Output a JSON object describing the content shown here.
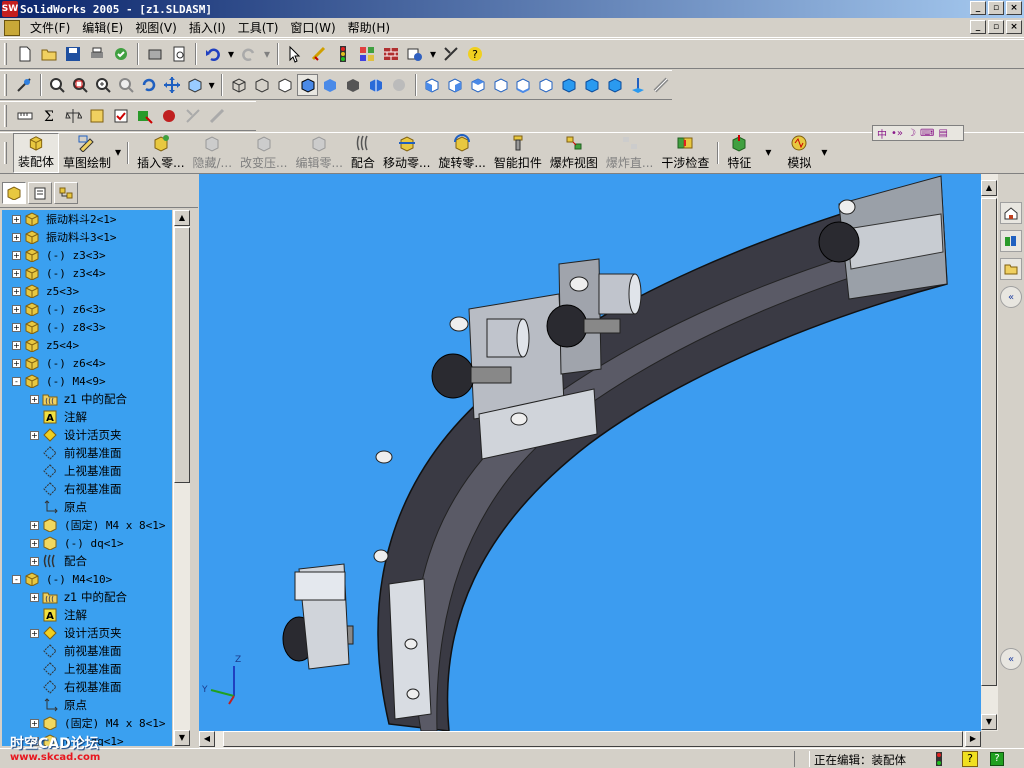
{
  "window": {
    "title": "SolidWorks 2005 - [z1.SLDASM]",
    "app_icon_text": "SW"
  },
  "menubar": {
    "items": [
      "文件(F)",
      "编辑(E)",
      "视图(V)",
      "插入(I)",
      "工具(T)",
      "窗口(W)",
      "帮助(H)"
    ]
  },
  "command_manager": {
    "buttons": [
      {
        "label": "装配体",
        "state": "pressed"
      },
      {
        "label": "草图绘制",
        "state": "pressed"
      },
      {
        "label": "插入零...",
        "state": "normal"
      },
      {
        "label": "隐藏/...",
        "state": "disabled"
      },
      {
        "label": "改变压...",
        "state": "disabled"
      },
      {
        "label": "编辑零...",
        "state": "disabled"
      },
      {
        "label": "配合",
        "state": "normal"
      },
      {
        "label": "移动零...",
        "state": "normal"
      },
      {
        "label": "旋转零...",
        "state": "normal"
      },
      {
        "label": "智能扣件",
        "state": "normal"
      },
      {
        "label": "爆炸视图",
        "state": "normal"
      },
      {
        "label": "爆炸直...",
        "state": "disabled"
      },
      {
        "label": "干涉检查",
        "state": "normal"
      },
      {
        "label": "特征",
        "state": "normal"
      },
      {
        "label": "模拟",
        "state": "normal"
      }
    ]
  },
  "feature_tree": {
    "items": [
      {
        "label": "振动料斗2<1>",
        "level": 0,
        "expander": "+",
        "icon": "assembly-icon"
      },
      {
        "label": "振动料斗3<1>",
        "level": 0,
        "expander": "+",
        "icon": "assembly-icon"
      },
      {
        "label": "(-) z3<3>",
        "level": 0,
        "expander": "+",
        "icon": "assembly-icon"
      },
      {
        "label": "(-) z3<4>",
        "level": 0,
        "expander": "+",
        "icon": "assembly-icon"
      },
      {
        "label": "z5<3>",
        "level": 0,
        "expander": "+",
        "icon": "assembly-icon"
      },
      {
        "label": "(-) z6<3>",
        "level": 0,
        "expander": "+",
        "icon": "assembly-icon"
      },
      {
        "label": "(-) z8<3>",
        "level": 0,
        "expander": "+",
        "icon": "assembly-icon"
      },
      {
        "label": "z5<4>",
        "level": 0,
        "expander": "+",
        "icon": "assembly-icon"
      },
      {
        "label": "(-) z6<4>",
        "level": 0,
        "expander": "+",
        "icon": "assembly-icon"
      },
      {
        "label": "(-) M4<9>",
        "level": 0,
        "expander": "-",
        "icon": "assembly-icon"
      },
      {
        "label": "z1 中的配合",
        "level": 1,
        "expander": "+",
        "icon": "mates-folder-icon"
      },
      {
        "label": "注解",
        "level": 1,
        "expander": "",
        "icon": "annotation-icon"
      },
      {
        "label": "设计活页夹",
        "level": 1,
        "expander": "+",
        "icon": "design-binder-icon"
      },
      {
        "label": "前视基准面",
        "level": 1,
        "expander": "",
        "icon": "plane-icon"
      },
      {
        "label": "上视基准面",
        "level": 1,
        "expander": "",
        "icon": "plane-icon"
      },
      {
        "label": "右视基准面",
        "level": 1,
        "expander": "",
        "icon": "plane-icon"
      },
      {
        "label": "原点",
        "level": 1,
        "expander": "",
        "icon": "origin-icon"
      },
      {
        "label": "(固定) M4 x 8<1>",
        "level": 1,
        "expander": "+",
        "icon": "part-icon"
      },
      {
        "label": "(-) dq<1>",
        "level": 1,
        "expander": "+",
        "icon": "part-icon"
      },
      {
        "label": "配合",
        "level": 1,
        "expander": "+",
        "icon": "mates-icon"
      },
      {
        "label": "(-) M4<10>",
        "level": 0,
        "expander": "-",
        "icon": "assembly-icon"
      },
      {
        "label": "z1 中的配合",
        "level": 1,
        "expander": "+",
        "icon": "mates-folder-icon"
      },
      {
        "label": "注解",
        "level": 1,
        "expander": "",
        "icon": "annotation-icon"
      },
      {
        "label": "设计活页夹",
        "level": 1,
        "expander": "+",
        "icon": "design-binder-icon"
      },
      {
        "label": "前视基准面",
        "level": 1,
        "expander": "",
        "icon": "plane-icon"
      },
      {
        "label": "上视基准面",
        "level": 1,
        "expander": "",
        "icon": "plane-icon"
      },
      {
        "label": "右视基准面",
        "level": 1,
        "expander": "",
        "icon": "plane-icon"
      },
      {
        "label": "原点",
        "level": 1,
        "expander": "",
        "icon": "origin-icon"
      },
      {
        "label": "(固定) M4 x 8<1>",
        "level": 1,
        "expander": "+",
        "icon": "part-icon"
      },
      {
        "label": "(-) dq<1>",
        "level": 1,
        "expander": "+",
        "icon": "part-icon"
      }
    ]
  },
  "triad": {
    "z": "Z",
    "y": "Y"
  },
  "statusbar": {
    "text": "正在编辑：装配体"
  },
  "watermark": {
    "text": "时空CAD论坛",
    "url": "www.skcad.com"
  },
  "colors": {
    "viewport_bg": "#3c9cf0",
    "tree_bg": "#3aa0f0",
    "title_start": "#0a246a"
  }
}
